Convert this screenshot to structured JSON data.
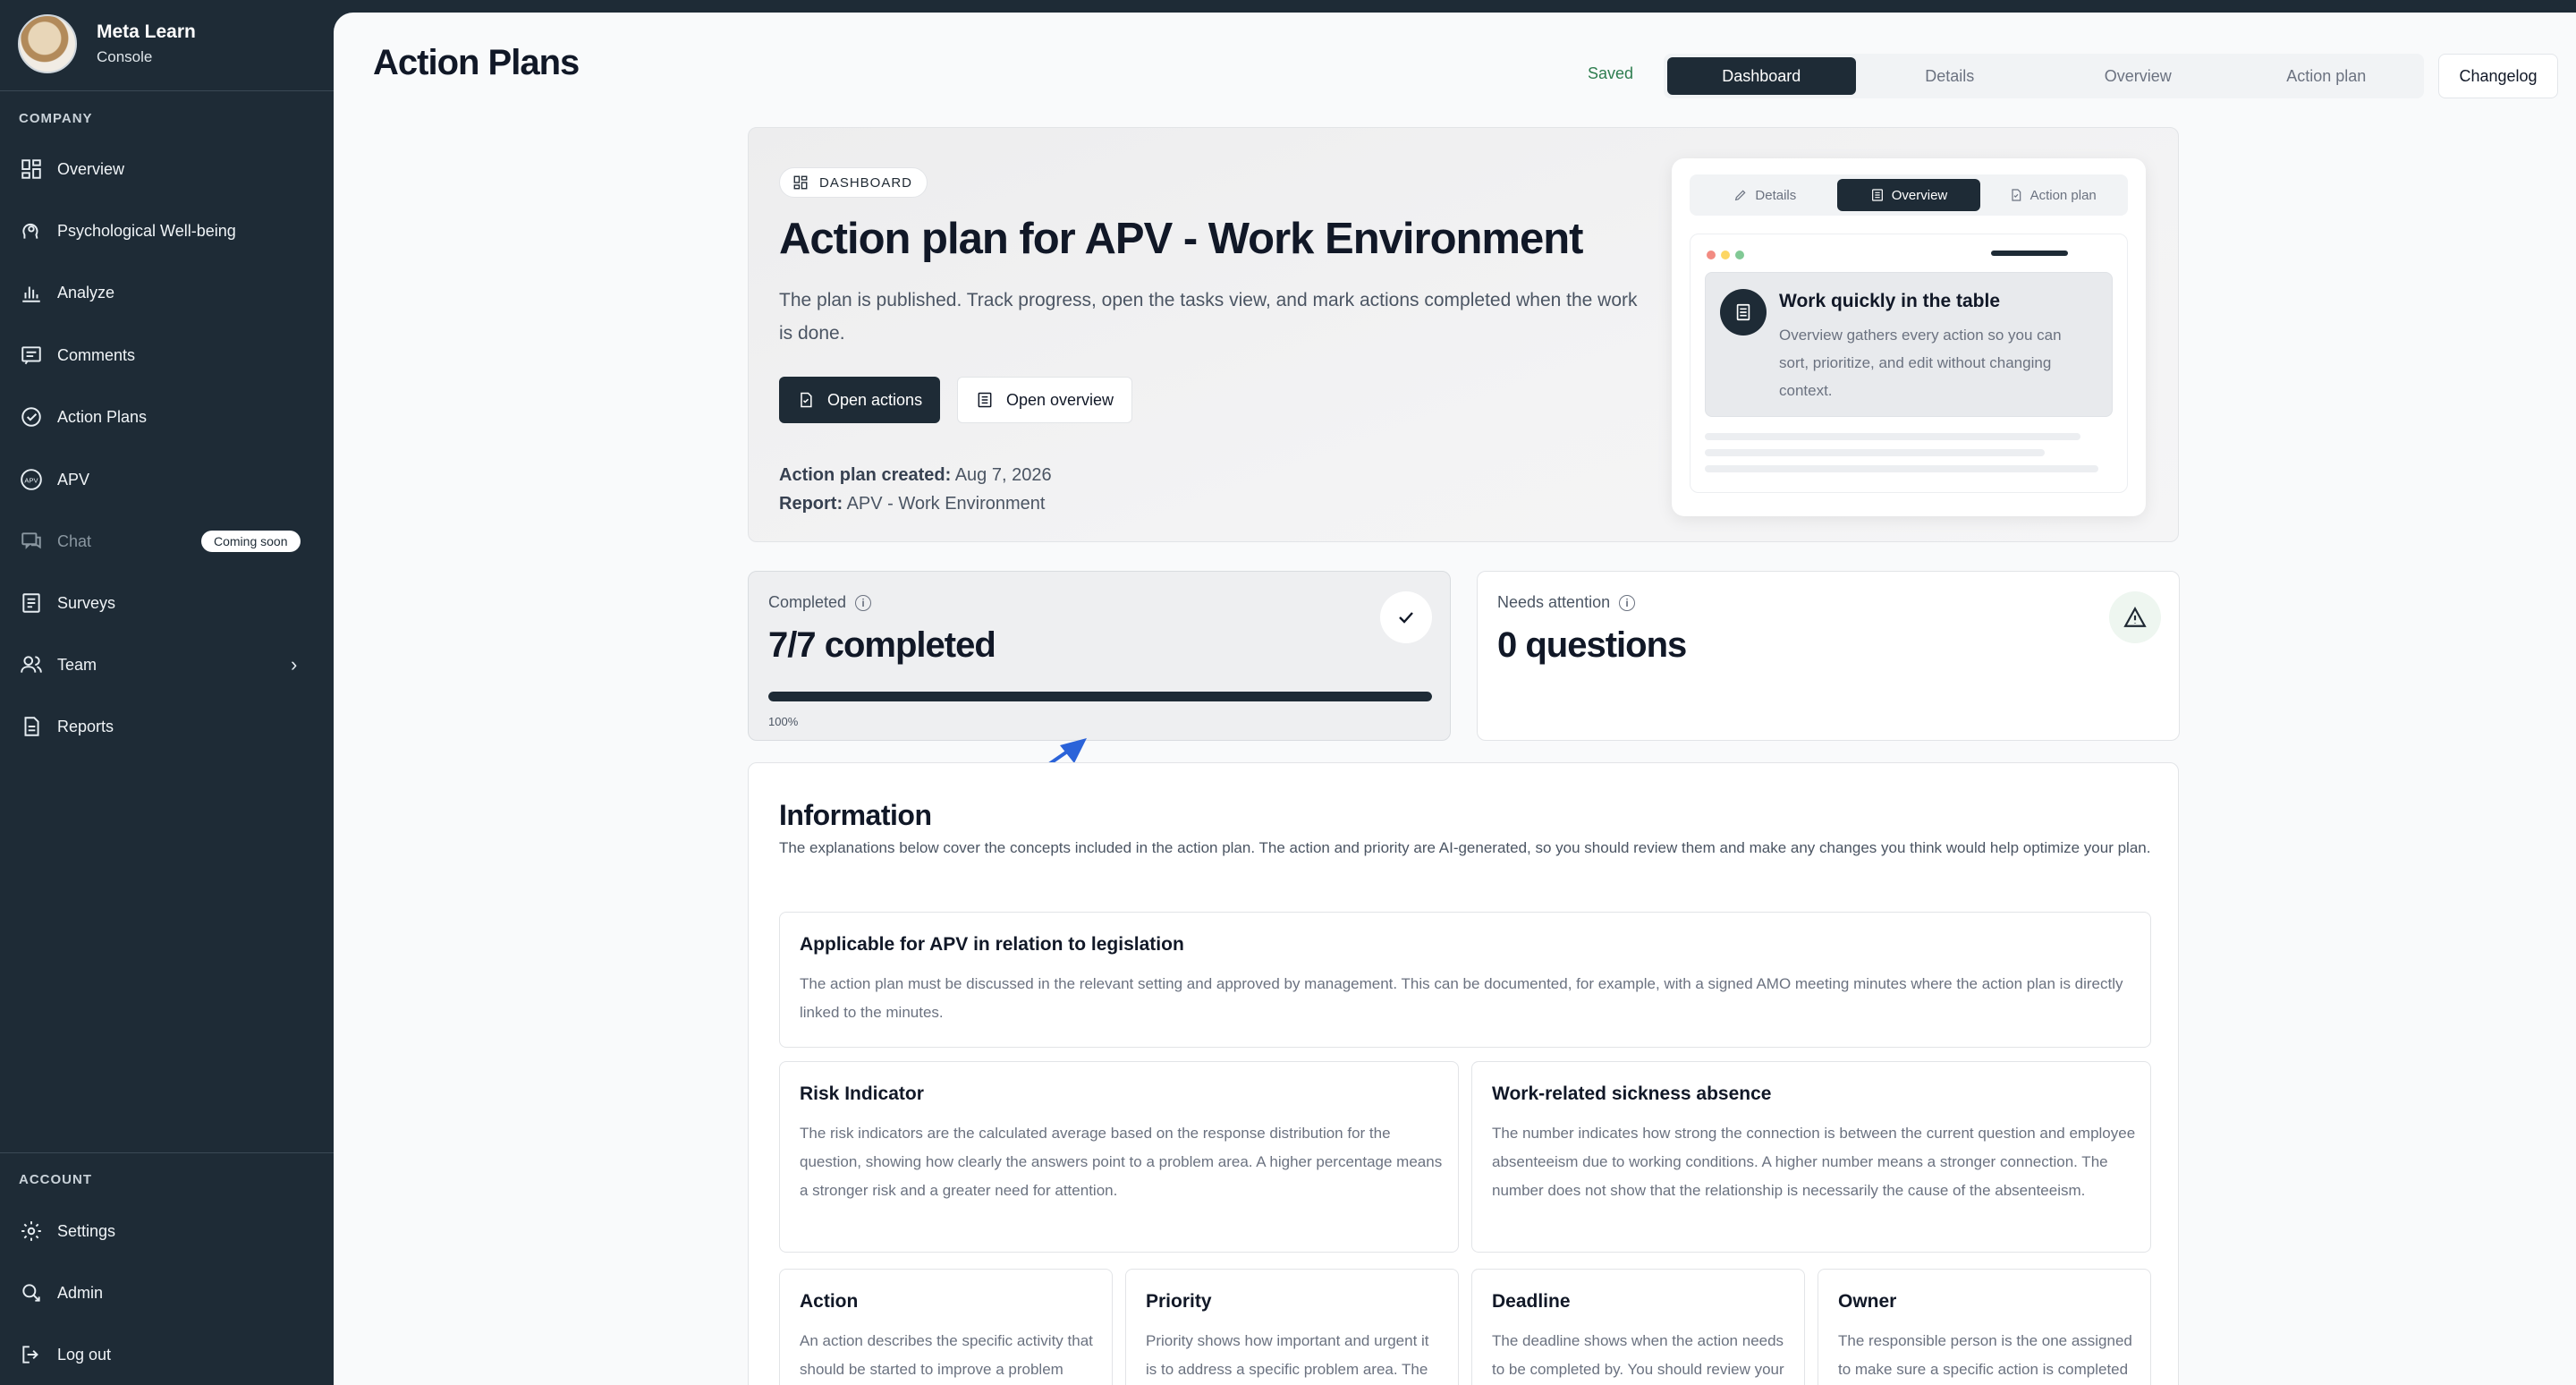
{
  "sidebar": {
    "brand": {
      "title": "Meta Learn",
      "subtitle": "Console"
    },
    "company_label": "COMPANY",
    "items": [
      {
        "label": "Overview",
        "icon": "grid-icon"
      },
      {
        "label": "Psychological Well-being",
        "icon": "head-icon"
      },
      {
        "label": "Analyze",
        "icon": "bar-chart-icon"
      },
      {
        "label": "Comments",
        "icon": "comment-icon"
      },
      {
        "label": "Action Plans",
        "icon": "check-circle-icon"
      },
      {
        "label": "APV",
        "icon": "apv-icon"
      },
      {
        "label": "Chat",
        "icon": "chat-icon",
        "badge": "Coming soon"
      },
      {
        "label": "Surveys",
        "icon": "clipboard-icon"
      },
      {
        "label": "Team",
        "icon": "team-icon"
      },
      {
        "label": "Reports",
        "icon": "report-icon"
      }
    ],
    "account_label": "ACCOUNT",
    "account_items": [
      {
        "label": "Settings",
        "icon": "gear-icon"
      },
      {
        "label": "Admin",
        "icon": "admin-icon"
      },
      {
        "label": "Log out",
        "icon": "logout-icon"
      }
    ]
  },
  "header": {
    "title": "Action Plans",
    "saved": "Saved",
    "tabs": [
      "Dashboard",
      "Details",
      "Overview",
      "Action plan"
    ],
    "active_tab": "Dashboard",
    "changelog": "Changelog"
  },
  "hero": {
    "pill": "DASHBOARD",
    "title": "Action plan for APV - Work Environment",
    "description": "The plan is published. Track progress, open the tasks view, and mark actions completed when the work is done.",
    "open_actions": "Open actions",
    "open_overview": "Open overview",
    "created_label": "Action plan created:",
    "created_value": "Aug 7, 2026",
    "report_label": "Report:",
    "report_value": "APV - Work Environment",
    "preview": {
      "tabs": [
        "Details",
        "Overview",
        "Action plan"
      ],
      "active_tab": "Overview",
      "title": "Work quickly in the table",
      "text": "Overview gathers every action so you can sort, prioritize, and edit without changing context."
    }
  },
  "stats": {
    "completed": {
      "label": "Completed",
      "value": "7/7 completed",
      "progress_label": "100%",
      "progress": 1.0
    },
    "attention": {
      "label": "Needs attention",
      "value": "0 questions"
    }
  },
  "information": {
    "title": "Information",
    "description": "The explanations below cover the concepts included in the action plan. The action and priority are AI-generated, so you should review them and make any changes you think would help optimize your plan.",
    "cards": [
      {
        "title": "Applicable for APV in relation to legislation",
        "text": "The action plan must be discussed in the relevant setting and approved by management. This can be documented, for example, with a signed AMO meeting minutes where the action plan is directly linked to the minutes."
      },
      {
        "title": "Risk Indicator",
        "text": "The risk indicators are the calculated average based on the response distribution for the question, showing how clearly the answers point to a problem area. A higher percentage means a stronger risk and a greater need for attention."
      },
      {
        "title": "Work-related sickness absence",
        "text": "The number indicates how strong the connection is between the current question and employee absenteeism due to working conditions. A higher number means a stronger connection. The number does not show that the relationship is necessarily the cause of the absenteeism."
      },
      {
        "title": "Action",
        "text": "An action describes the specific activity that should be started to improve a problem area. Actions are AI-generated"
      },
      {
        "title": "Priority",
        "text": "Priority shows how important and urgent it is to address a specific problem area. The priority is AI-"
      },
      {
        "title": "Deadline",
        "text": "The deadline shows when the action needs to be completed by. You should review your action no later than this"
      },
      {
        "title": "Owner",
        "text": "The responsible person is the one assigned to make sure a specific action is completed by the given deadline."
      }
    ]
  },
  "colors": {
    "sidebar_bg": "#1e2b36",
    "accent": "#1e2b36",
    "saved": "#2e7d4f",
    "arrow": "#2b63d9"
  }
}
